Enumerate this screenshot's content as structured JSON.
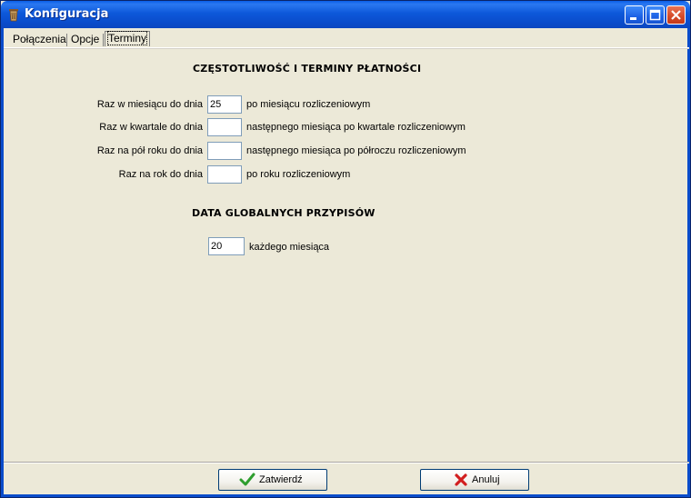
{
  "window": {
    "title": "Konfiguracja"
  },
  "tabs": [
    "Połączenia",
    "Opcje",
    "Terminy"
  ],
  "section1": {
    "heading": "CZĘSTOTLIWOŚĆ I TERMINY PŁATNOŚCI",
    "rows": [
      {
        "label": "Raz w miesiącu do dnia",
        "value": "25",
        "suffix": "po miesiącu rozliczeniowym"
      },
      {
        "label": "Raz w kwartale do dnia",
        "value": "",
        "suffix": "następnego miesiąca po kwartale rozliczeniowym"
      },
      {
        "label": "Raz na pół roku do dnia",
        "value": "",
        "suffix": "następnego miesiąca po półroczu rozliczeniowym"
      },
      {
        "label": "Raz na rok do dnia",
        "value": "",
        "suffix": "po roku rozliczeniowym"
      }
    ]
  },
  "section2": {
    "heading": "DATA GLOBALNYCH PRZYPISÓW",
    "value": "20",
    "suffix": "każdego miesiąca"
  },
  "buttons": {
    "ok": "Zatwierdź",
    "cancel": "Anuluj"
  },
  "colors": {
    "titlebar": "#0A4CCB",
    "background": "#ECE9D8",
    "ok_icon": "#2E9E2E",
    "cancel_icon": "#D21F1F"
  }
}
